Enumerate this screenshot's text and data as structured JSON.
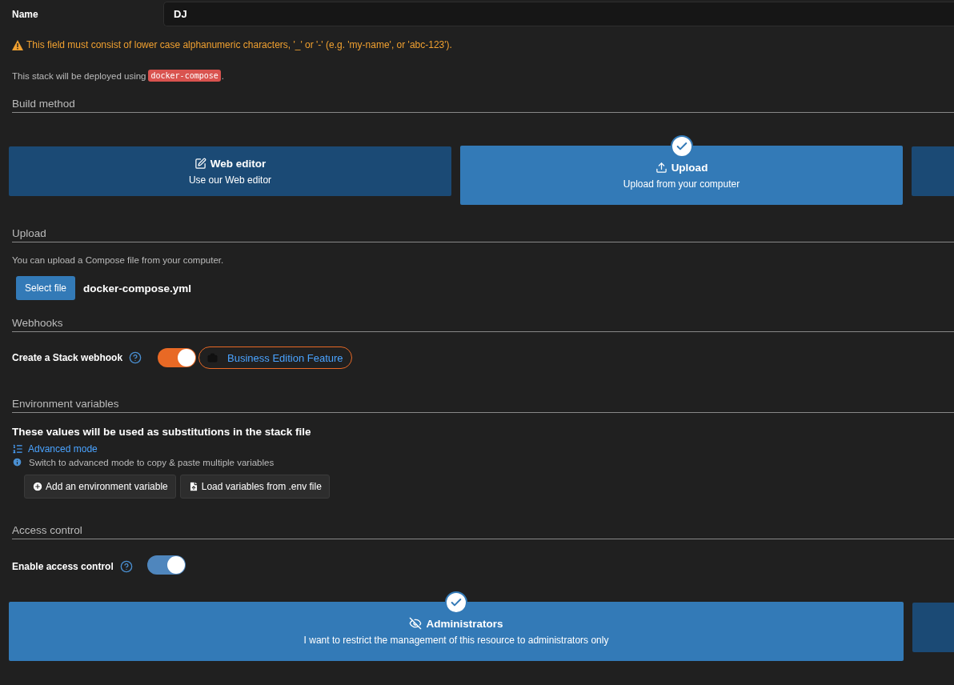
{
  "name_field": {
    "label": "Name",
    "value": "DJ"
  },
  "warning": "This field must consist of lower case alphanumeric characters, '_' or '-' (e.g. 'my-name', or 'abc-123').",
  "deploy_note": {
    "before": "This stack will be deployed using",
    "code": "docker-compose",
    "after": "."
  },
  "build_method": {
    "title": "Build method",
    "options": [
      {
        "title": "Web editor",
        "description": "Use our Web editor",
        "kind": "editor",
        "selected": false
      },
      {
        "title": "Upload",
        "description": "Upload from your computer",
        "kind": "upload",
        "selected": true
      },
      {
        "kind": "blank",
        "selected": false
      }
    ]
  },
  "upload": {
    "title": "Upload",
    "hint": "You can upload a Compose file from your computer.",
    "button": "Select file",
    "file_name": "docker-compose.yml"
  },
  "webhooks": {
    "title": "Webhooks",
    "label": "Create a Stack webhook",
    "on": true,
    "badge": "Business Edition Feature"
  },
  "env": {
    "title": "Environment variables",
    "lead": "These values will be used as substitutions in the stack file",
    "advanced_link": "Advanced mode",
    "info": "Switch to advanced mode to copy & paste multiple variables",
    "buttons": [
      {
        "label": "Add an environment variable",
        "kind": "add"
      },
      {
        "label": "Load variables from .env file",
        "kind": "file"
      }
    ]
  },
  "access": {
    "title": "Access control",
    "label": "Enable access control",
    "on": true,
    "options": [
      {
        "title": "Administrators",
        "description": "I want to restrict the management of this resource to administrators only",
        "kind": "admins",
        "selected": true
      },
      {
        "kind": "blank",
        "selected": false
      }
    ]
  }
}
